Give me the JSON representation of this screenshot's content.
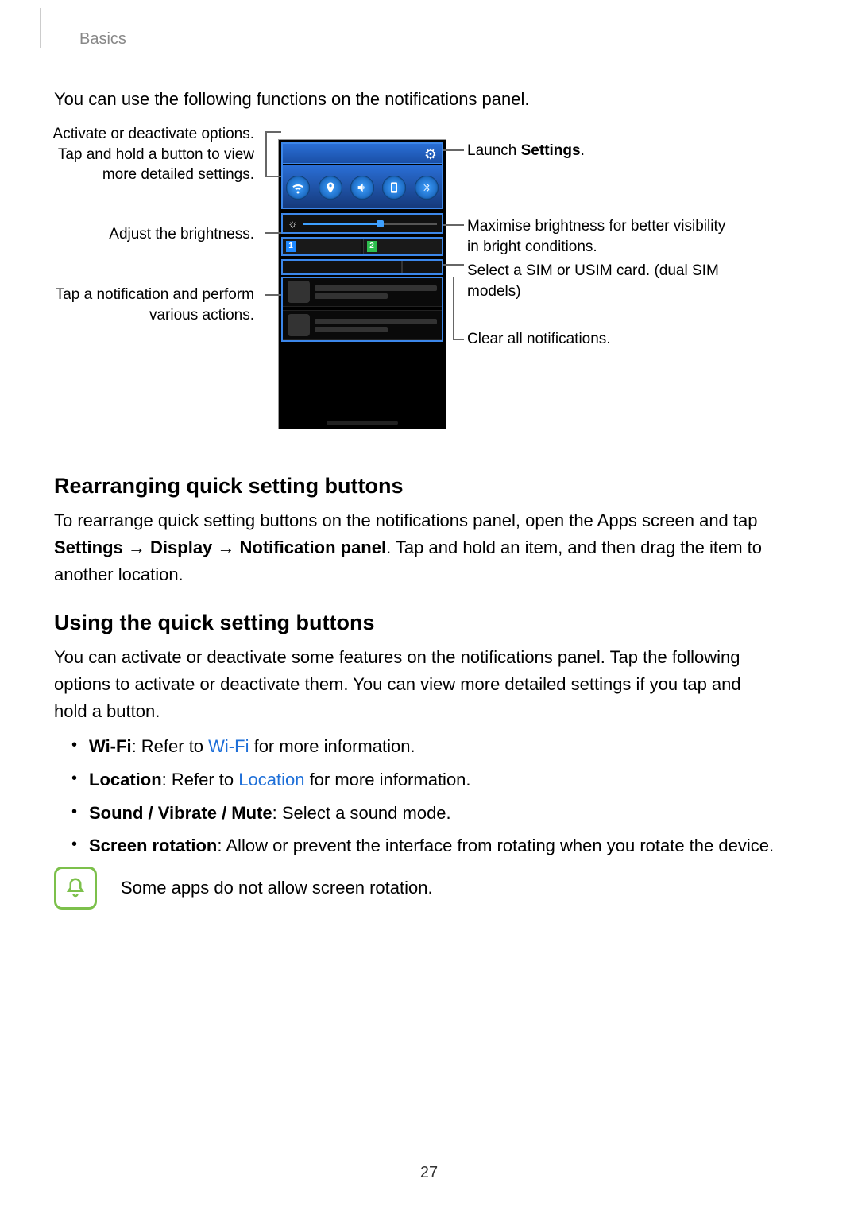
{
  "header": {
    "section": "Basics"
  },
  "intro": "You can use the following functions on the notifications panel.",
  "callouts": {
    "left_options": "Activate or deactivate options. Tap and hold a button to view more detailed settings.",
    "left_brightness": "Adjust the brightness.",
    "left_notification": "Tap a notification and perform various actions.",
    "right_settings_pre": "Launch ",
    "right_settings_bold": "Settings",
    "right_settings_post": ".",
    "right_maxbright": "Maximise brightness for better visibility in bright conditions.",
    "right_sim": "Select a SIM or USIM card. (dual SIM models)",
    "right_clear": "Clear all notifications."
  },
  "sim": {
    "badge1": "1",
    "badge2": "2"
  },
  "rearranging": {
    "heading": "Rearranging quick setting buttons",
    "p_pre": "To rearrange quick setting buttons on the notifications panel, open the Apps screen and tap ",
    "p_b1": "Settings",
    "p_arrow": " → ",
    "p_b2": "Display",
    "p_b3": "Notification panel",
    "p_post": ". Tap and hold an item, and then drag the item to another location."
  },
  "using": {
    "heading": "Using the quick setting buttons",
    "intro": "You can activate or deactivate some features on the notifications panel. Tap the following options to activate or deactivate them. You can view more detailed settings if you tap and hold a button.",
    "items": {
      "wifi_b": "Wi-Fi",
      "wifi_t1": ": Refer to ",
      "wifi_link": "Wi-Fi",
      "wifi_t2": " for more information.",
      "loc_b": "Location",
      "loc_t1": ": Refer to ",
      "loc_link": "Location",
      "loc_t2": " for more information.",
      "sound_b": "Sound / Vibrate / Mute",
      "sound_t": ": Select a sound mode.",
      "rot_b": "Screen rotation",
      "rot_t": ": Allow or prevent the interface from rotating when you rotate the device."
    }
  },
  "note": "Some apps do not allow screen rotation.",
  "page": "27"
}
